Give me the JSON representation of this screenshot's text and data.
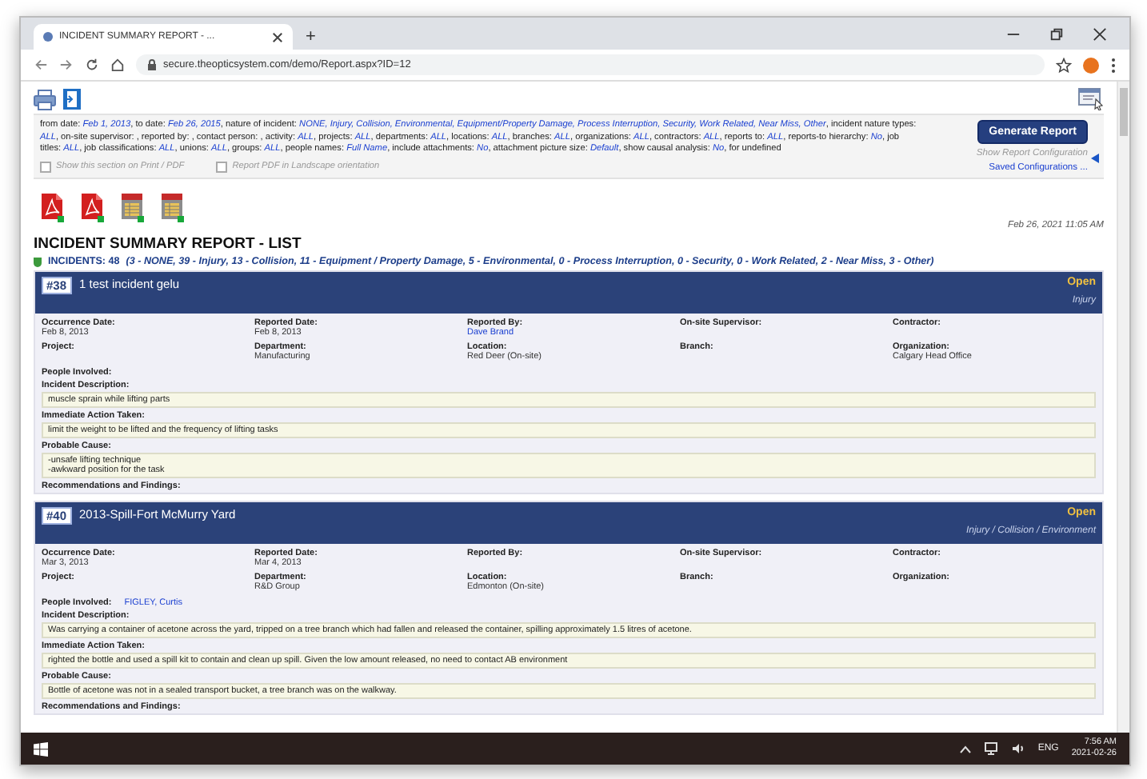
{
  "browser": {
    "tab_title": "INCIDENT SUMMARY REPORT - ...",
    "new_tab": "+",
    "url": "secure.theopticsystem.com/demo/Report.aspx?ID=12"
  },
  "config": {
    "parameters": "from date: *Feb 1, 2013*, to date: *Feb 26, 2015*, nature of incident: *NONE, Injury, Collision, Environmental, Equipment/Property Damage, Process Interruption, Security, Work Related, Near Miss, Other*, incident nature types: *ALL*, on-site supervisor: , reported by: , contact person: , activity: *ALL*, projects: *ALL*, departments: *ALL*, locations: *ALL*, branches: *ALL*, organizations: *ALL*, contractors: *ALL*, reports to: *ALL*, reports-to hierarchy: *No*, job titles: *ALL*, job classifications: *ALL*, unions: *ALL*, groups: *ALL*, people names: *Full Name*, include attachments: *No*, attachment picture size: *Default*, show causal analysis: *No*, for undefined",
    "options": [
      {
        "label": "Show this section on Print / PDF",
        "checked": false
      },
      {
        "label": "Report PDF in Landscape orientation",
        "checked": false
      }
    ],
    "generate_button": "Generate Report",
    "show_config": "Show Report Configuration",
    "saved_configs": "Saved Configurations ..."
  },
  "exports": [
    {
      "kind": "pdf"
    },
    {
      "kind": "pdf"
    },
    {
      "kind": "sheet"
    },
    {
      "kind": "sheet"
    }
  ],
  "generated": "Feb 26, 2021 11:05 AM",
  "report_title": "INCIDENT SUMMARY REPORT - LIST",
  "summary": {
    "count": "INCIDENTS: 48",
    "breakdown": "(3 - NONE, 39 - Injury, 13 - Collision, 11 - Equipment / Property Damage, 5 - Environmental, 0 - Process Interruption, 0 - Security, 0 - Work Related, 2 - Near Miss, 3 - Other)"
  },
  "incidents": [
    {
      "number": "#38",
      "title": "1 test incident gelu",
      "status": "Open",
      "types": "Injury",
      "fields": [
        {
          "label": "Occurrence Date:",
          "value": "Feb 8, 2013",
          "kind": "text"
        },
        {
          "label": "Reported Date:",
          "value": "Feb 8, 2013",
          "kind": "text"
        },
        {
          "label": "Reported By:",
          "value": "Dave Brand",
          "kind": "link"
        },
        {
          "label": "On-site Supervisor:"
        },
        {
          "label": "Contractor:"
        },
        {
          "label": "Project:"
        },
        {
          "label": "Department:",
          "value": "Manufacturing",
          "kind": "text"
        },
        {
          "label": "Location:",
          "value": "Red Deer (On-site)",
          "kind": "text"
        },
        {
          "label": "Branch:"
        },
        {
          "label": "Organization:",
          "value": "Calgary Head Office",
          "kind": "text"
        }
      ],
      "people_label": "People Involved:",
      "sections": [
        {
          "label": "Incident Description:",
          "lines": [
            "muscle sprain while lifting parts"
          ]
        },
        {
          "label": "Immediate Action Taken:",
          "lines": [
            "limit the weight to be lifted and the frequency of lifting tasks"
          ]
        },
        {
          "label": "Probable Cause:",
          "lines": [
            "-unsafe lifting technique",
            "-awkward position for the task"
          ]
        },
        {
          "label": "Recommendations and Findings:"
        }
      ]
    },
    {
      "number": "#40",
      "title": "2013-Spill-Fort McMurry Yard",
      "status": "Open",
      "types": "Injury / Collision / Environment",
      "fields": [
        {
          "label": "Occurrence Date:",
          "value": "Mar 3, 2013",
          "kind": "text"
        },
        {
          "label": "Reported Date:",
          "value": "Mar 4, 2013",
          "kind": "text"
        },
        {
          "label": "Reported By:"
        },
        {
          "label": "On-site Supervisor:"
        },
        {
          "label": "Contractor:"
        },
        {
          "label": "Project:"
        },
        {
          "label": "Department:",
          "value": "R&D Group",
          "kind": "text"
        },
        {
          "label": "Location:",
          "value": "Edmonton (On-site)",
          "kind": "text"
        },
        {
          "label": "Branch:"
        },
        {
          "label": "Organization:"
        }
      ],
      "people_label": "People Involved:",
      "people": "FIGLEY, Curtis",
      "sections": [
        {
          "label": "Incident Description:",
          "lines": [
            "Was carrying a container of acetone across the yard, tripped on a tree branch which had fallen and released the container, spilling approximately 1.5 litres of acetone."
          ]
        },
        {
          "label": "Immediate Action Taken:",
          "lines": [
            "righted the bottle and used a spill kit to contain and clean up spill. Given the low amount released, no need to contact AB environment"
          ]
        },
        {
          "label": "Probable Cause:",
          "lines": [
            "Bottle of acetone was not in a sealed transport bucket, a tree branch was on the walkway."
          ]
        },
        {
          "label": "Recommendations and Findings:"
        }
      ]
    }
  ],
  "taskbar": {
    "language": "ENG",
    "time": "7:56 AM",
    "date": "2021-02-26"
  }
}
